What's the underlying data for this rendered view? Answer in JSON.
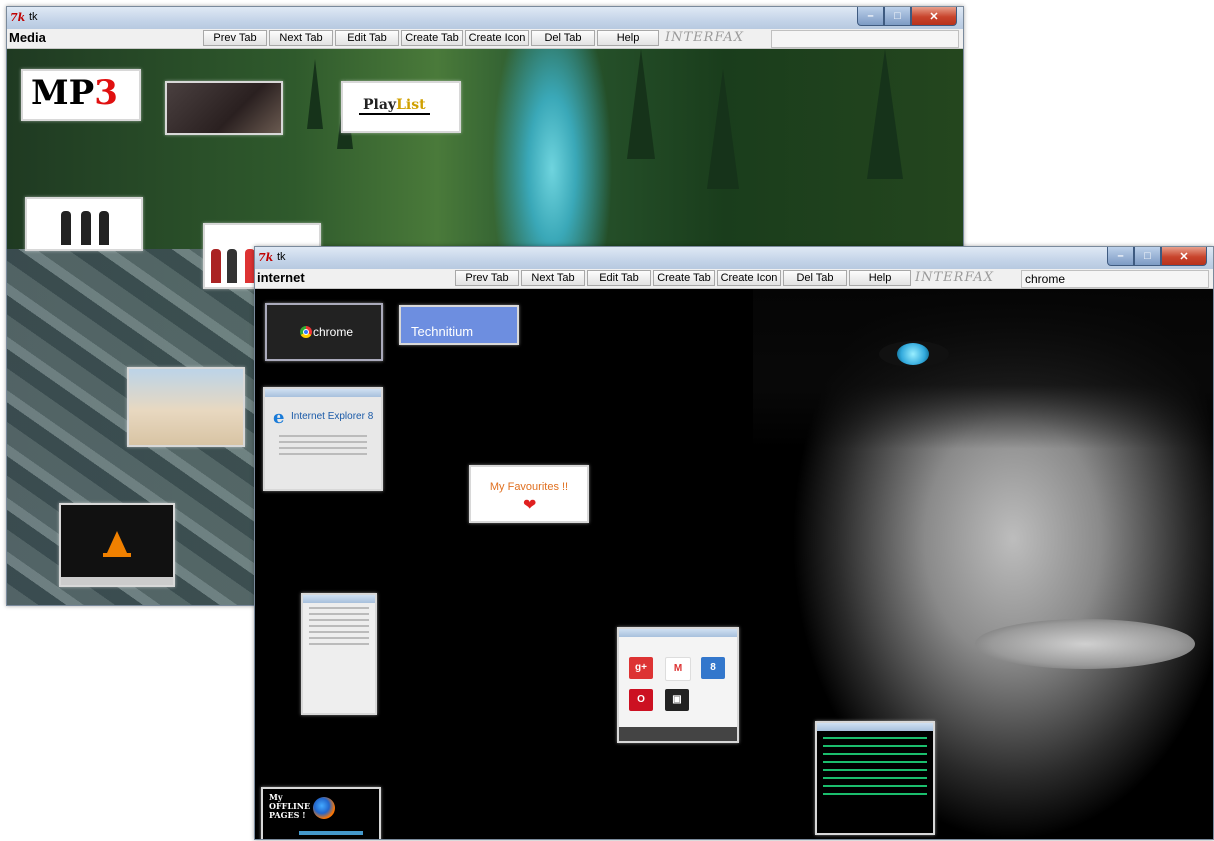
{
  "media_window": {
    "app_title": "tk",
    "tab_name": "Media",
    "buttons": [
      "Prev Tab",
      "Next Tab",
      "Edit Tab",
      "Create Tab",
      "Create Icon",
      "Del Tab",
      "Help"
    ],
    "brand": "INTERFAX",
    "icons": {
      "mp3": {
        "main": "MP",
        "accent": "3"
      },
      "playlist": {
        "main": "Play",
        "accent": "List"
      }
    }
  },
  "internet_window": {
    "app_title": "tk",
    "tab_name": "internet",
    "buttons": [
      "Prev Tab",
      "Next Tab",
      "Edit Tab",
      "Create Tab",
      "Create Icon",
      "Del Tab",
      "Help"
    ],
    "brand": "INTERFAX",
    "entry_value": "chrome",
    "icons": {
      "chrome": "chrome",
      "technitium": "Technitium",
      "favourites": "My Favourites !!",
      "ie": "Internet Explorer",
      "ie_version": "8",
      "offline": "My OFFLINE PAGES !"
    }
  },
  "colors": {
    "titlebar": "#c4d4e8",
    "close_button": "#c8442c",
    "mp3_accent": "#e01010",
    "playlist_accent": "#d0a000",
    "technitium_tile": "#6d8ee0",
    "eye_iris": "#33aadd"
  }
}
